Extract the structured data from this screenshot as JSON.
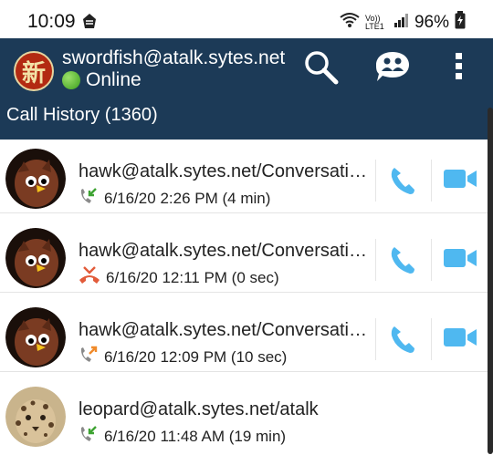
{
  "status_bar": {
    "time": "10:09",
    "network": "Vo)) LTE1",
    "battery": "96%"
  },
  "appbar": {
    "avatar_glyph": "新",
    "account": "swordfish@atalk.sytes.net",
    "presence": "Online",
    "actions": [
      "search-icon",
      "contacts-bubble-icon",
      "more-vertical-icon"
    ]
  },
  "subtitle": "Call History (1360)",
  "calls": [
    {
      "name": "hawk@atalk.sytes.net/Conversations",
      "time": "6/16/20 2:26 PM (4 min)",
      "type": "incoming"
    },
    {
      "name": "hawk@atalk.sytes.net/Conversations",
      "time": "6/16/20 12:11 PM (0 sec)",
      "type": "missed"
    },
    {
      "name": "hawk@atalk.sytes.net/Conversations",
      "time": "6/16/20 12:09 PM (10 sec)",
      "type": "outgoing"
    },
    {
      "name": "leopard@atalk.sytes.net/atalk",
      "time": "6/16/20 11:48 AM (19 min)",
      "type": "incoming"
    }
  ],
  "colors": {
    "appbar": "#1c3a57",
    "call_action": "#4fb8f0",
    "incoming": "#3ea332",
    "missed": "#e25b3a",
    "outgoing": "#f08a2a"
  }
}
